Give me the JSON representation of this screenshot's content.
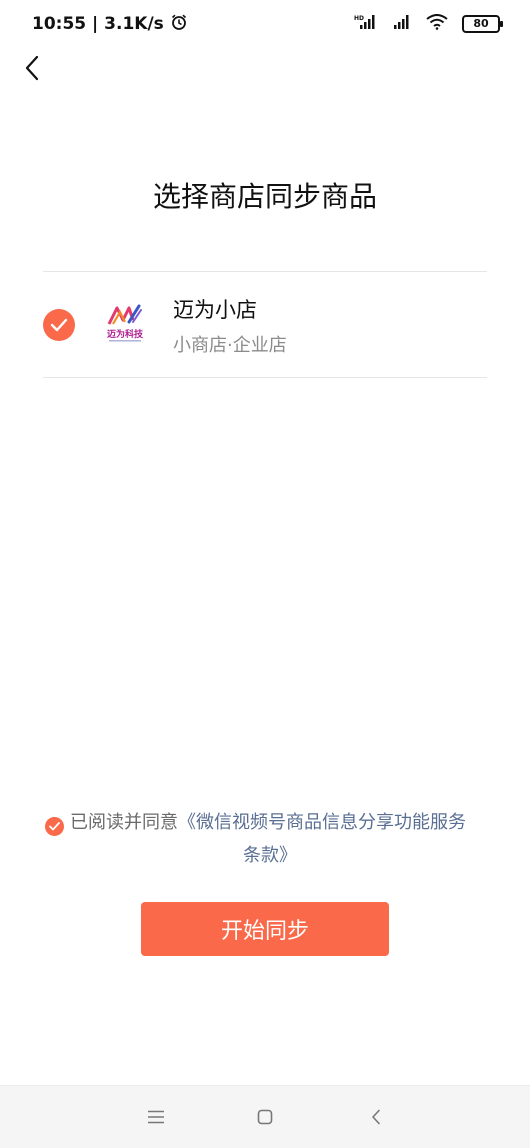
{
  "status_bar": {
    "time_speed": "10:55 | 3.1K/s",
    "battery": "80",
    "icons": [
      "alarm-icon",
      "hd-signal-icon",
      "signal-icon",
      "wifi-icon",
      "battery-icon"
    ]
  },
  "header": {
    "title": "选择商店同步商品",
    "back_icon": "chevron-left-icon"
  },
  "store": {
    "name": "迈为小店",
    "subtitle": "小商店·企业店",
    "logo_text": "迈为科技",
    "selected": true
  },
  "agreement": {
    "prefix": "已阅读并同意",
    "link_part1": "《微信视频号商品信息分享功能服务",
    "link_part2": "条款》",
    "checked": true
  },
  "actions": {
    "start_label": "开始同步"
  },
  "nav_bar": {
    "icons": [
      "menu-icon",
      "home-icon",
      "back-icon"
    ]
  },
  "colors": {
    "accent": "#fa6a4a",
    "link": "#5a6f93",
    "muted": "#8b8b8b"
  }
}
